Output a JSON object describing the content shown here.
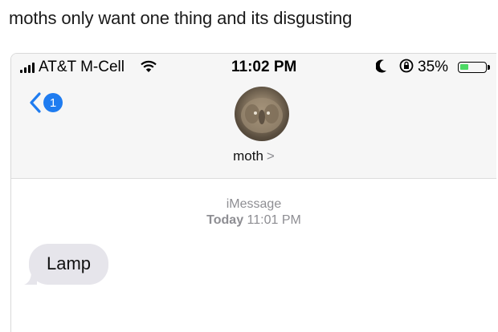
{
  "caption": "moths only want one thing and its disgusting",
  "status_bar": {
    "carrier": "AT&T M-Cell",
    "time": "11:02 PM",
    "battery_percent": "35%",
    "battery_level": 0.35,
    "battery_color": "#4cd964"
  },
  "nav": {
    "unread_count": "1",
    "contact_name": "moth",
    "contact_chevron": ">"
  },
  "thread": {
    "service": "iMessage",
    "date_label": "Today",
    "date_time": "11:01 PM"
  },
  "messages": [
    {
      "direction": "incoming",
      "text": "Lamp"
    }
  ],
  "colors": {
    "accent": "#1f7cf0",
    "bubble_incoming": "#e6e5eb",
    "meta_text": "#8e8e93"
  }
}
